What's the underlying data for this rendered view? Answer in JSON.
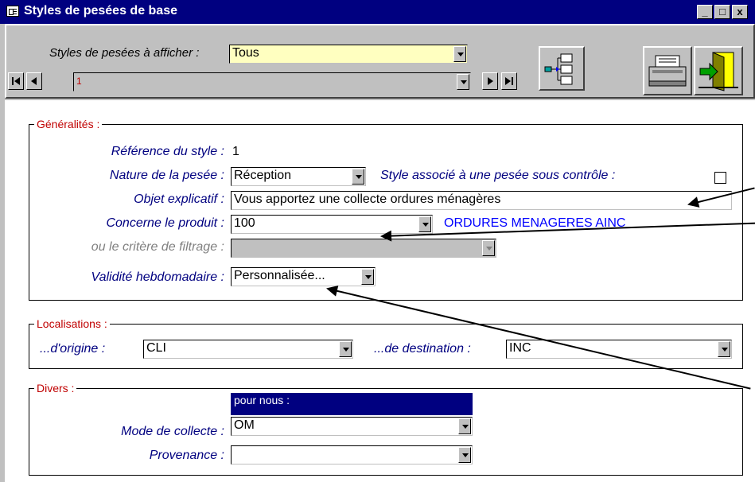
{
  "window": {
    "title": "Styles de pesées de base",
    "controls": [
      "_",
      "□",
      "x"
    ]
  },
  "toolbar": {
    "filter_label": "Styles de pesées à afficher :",
    "filter_value": "Tous",
    "record_value": "1"
  },
  "generalites": {
    "title": "Généralités :",
    "ref_label": "Référence du style :",
    "ref_value": "1",
    "nature_label": "Nature de la pesée :",
    "nature_value": "Réception",
    "controle_label": "Style associé à une pesée sous contrôle :",
    "objet_label": "Objet explicatif :",
    "objet_value": "Vous apportez une collecte ordures ménagères",
    "produit_label": "Concerne le produit :",
    "produit_value": "100",
    "produit_name": "ORDURES MENAGERES AINC",
    "filtrage_label": "ou le critère de filtrage :",
    "filtrage_value": "",
    "validite_label": "Validité hebdomadaire :",
    "validite_value": "Personnalisée..."
  },
  "localisations": {
    "title": "Localisations :",
    "origine_label": "...d'origine :",
    "origine_value": "CLI",
    "destination_label": "...de destination :",
    "destination_value": "INC"
  },
  "divers": {
    "title": "Divers :",
    "collecte_header": "pour nous :",
    "collecte_label": "Mode de collecte :",
    "collecte_value": "OM",
    "provenance_label": "Provenance :",
    "provenance_value": ""
  },
  "colors": {
    "title_bar": "#000080",
    "filter_bg": "#ffffc0",
    "group_title": "#c00000",
    "label": "#000080",
    "product_link": "#0000ff"
  }
}
